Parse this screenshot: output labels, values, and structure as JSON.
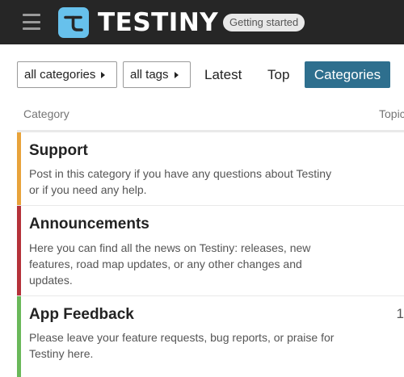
{
  "header": {
    "brand": "TESTINY",
    "badge": "Getting started"
  },
  "nav": {
    "categories_dropdown": "all categories",
    "tags_dropdown": "all tags",
    "latest": "Latest",
    "top": "Top",
    "categories": "Categories"
  },
  "table": {
    "col_category": "Category",
    "col_topics": "Topic"
  },
  "categories": [
    {
      "name": "Support",
      "description": "Post in this category if you have any questions about Testiny or if you need any help.",
      "color": "#e8a33b",
      "count": ""
    },
    {
      "name": "Announcements",
      "description": "Here you can find all the news on Testiny: releases, new features, road map updates, or any other changes and updates.",
      "color": "#b5323a",
      "count": ""
    },
    {
      "name": "App Feedback",
      "description": "Please leave your feature requests, bug reports, or praise for Testiny here.",
      "color": "#6ab85a",
      "count": "1"
    }
  ],
  "colors": {
    "header_bg": "#262626",
    "logo_bg": "#67c1ec",
    "active_nav": "#2e6f8e"
  },
  "icons": {
    "menu": "hamburger-menu-icon",
    "logo": "testiny-logo-icon",
    "caret": "caret-right-icon"
  }
}
